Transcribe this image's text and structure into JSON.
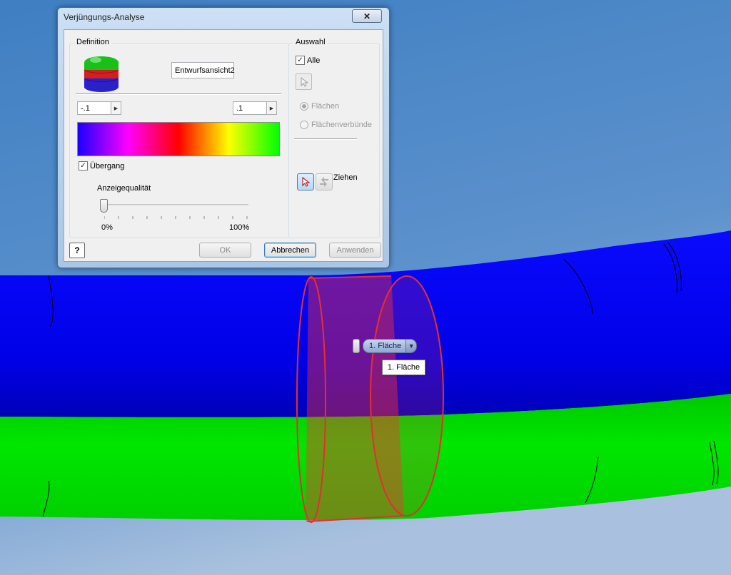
{
  "dialog": {
    "title": "Verjüngungs-Analyse",
    "close_symbol": "✕",
    "definition": {
      "group_label": "Definition",
      "name_value": "Entwurfsansicht2",
      "min_value": "-.1",
      "max_value": ".1",
      "transition_label": "Übergang",
      "transition_checked": true,
      "quality_label": "Anzeigequalität",
      "quality_min_label": "0%",
      "quality_max_label": "100%",
      "quality_level": 0,
      "gradient_colors": [
        "#1a00ff",
        "#ff00ff",
        "#ff0000",
        "#ffff00",
        "#00ff00"
      ]
    },
    "selection": {
      "group_label": "Auswahl",
      "all_label": "Alle",
      "all_checked": true,
      "faces_label": "Flächen",
      "face_sets_label": "Flächenverbünde",
      "drag_label": "Ziehen"
    },
    "buttons": {
      "help_symbol": "?",
      "ok_label": "OK",
      "cancel_label": "Abbrechen",
      "apply_label": "Anwenden"
    }
  },
  "viewport": {
    "face_chip_label": "1. Fläche",
    "chip_arrow_symbol": "▼",
    "tooltip_label": "1. Fläche",
    "colors": {
      "background_top": "#4a86c8",
      "background_bottom": "#8fb0d6",
      "tube_blue": "#0000ee",
      "tube_green": "#00e000",
      "selection_outline": "#e23030"
    }
  },
  "icons": [
    "pointer-icon",
    "drag-icon",
    "help-icon",
    "color-cylinder-icon",
    "close-icon"
  ]
}
